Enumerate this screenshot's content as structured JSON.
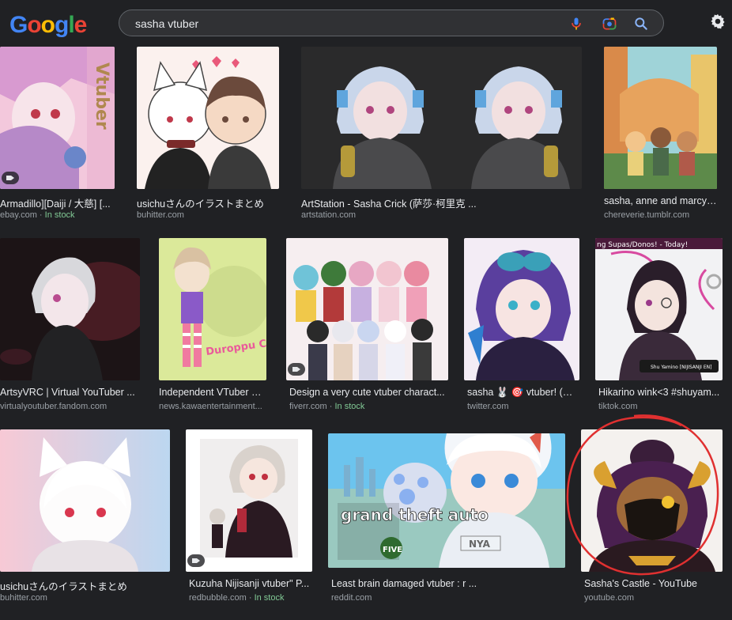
{
  "header": {
    "logo_text": "Google",
    "query": "sasha vtuber"
  },
  "colors": {
    "background": "#202124",
    "logo_letters": [
      "#4285f4",
      "#ea4335",
      "#fbbc05",
      "#4285f4",
      "#34a853",
      "#ea4335"
    ],
    "in_stock": "#81c995"
  },
  "icons": [
    "mic-icon",
    "lens-icon",
    "search-icon",
    "gear-icon",
    "shopping-tag-icon"
  ],
  "results": [
    {
      "caption": "Armadillo][Daiji / 大慈] [...",
      "source": "ebay.com",
      "stock": "In stock"
    },
    {
      "caption": "usichuさんのイラストまとめ",
      "source": "buhitter.com",
      "stock": ""
    },
    {
      "caption": "ArtStation - Sasha Crick (萨莎·柯里克 ...",
      "source": "artstation.com",
      "stock": ""
    },
    {
      "caption": "sasha, anne and marcy ...",
      "source": "chereverie.tumblr.com",
      "stock": ""
    },
    {
      "caption": "ArtsyVRC | Virtual YouTuber ...",
      "source": "virtualyoutuber.fandom.com",
      "stock": ""
    },
    {
      "caption": "Independent VTuber D...",
      "source": "news.kawaentertainment...",
      "stock": ""
    },
    {
      "caption": "Design a very cute vtuber charact...",
      "source": "fiverr.com",
      "stock": "In stock"
    },
    {
      "caption": "sasha 🐰 🎯 vtuber! (@...",
      "source": "twitter.com",
      "stock": ""
    },
    {
      "caption": "Hikarino wink<3 #shuyam...",
      "source": "tiktok.com",
      "stock": ""
    },
    {
      "caption": "usichuさんのイラストまとめ",
      "source": "buhitter.com",
      "stock": ""
    },
    {
      "caption": "Kuzuha Nijisanji vtuber\" P...",
      "source": "redbubble.com",
      "stock": "In stock"
    },
    {
      "caption": "Least brain damaged vtuber : r ...",
      "source": "reddit.com",
      "stock": ""
    },
    {
      "caption": "Sasha's Castle - YouTube",
      "source": "youtube.com",
      "stock": ""
    }
  ],
  "image_text": {
    "vtuber_cover": "Vtuber",
    "stream_banner": "ng Supas/Donos! - Today!",
    "stream_name": "Shu Yamino [NIJISANJI EN]",
    "poster": "Duroppu Charming",
    "gta_logo": "grand theft auto",
    "gta_five": "FIVE",
    "shirt": "NYA"
  }
}
